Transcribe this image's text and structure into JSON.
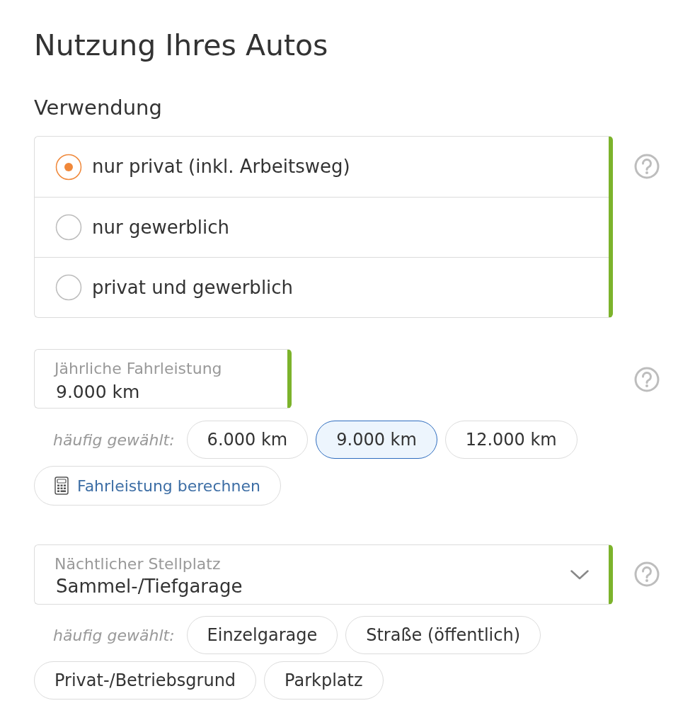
{
  "title": "Nutzung Ihres Autos",
  "usage": {
    "heading": "Verwendung",
    "valid": true,
    "options": [
      {
        "label": "nur privat (inkl. Arbeitsweg)",
        "selected": true
      },
      {
        "label": "nur gewerblich",
        "selected": false
      },
      {
        "label": "privat und gewerblich",
        "selected": false
      }
    ]
  },
  "mileage": {
    "label": "Jährliche Fahrleistung",
    "value": "9.000 km",
    "valid": true,
    "suggestions_label": "häufig gewählt:",
    "suggestions": [
      {
        "label": "6.000 km",
        "selected": false
      },
      {
        "label": "9.000 km",
        "selected": true
      },
      {
        "label": "12.000 km",
        "selected": false
      }
    ],
    "calculate_button": "Fahrleistung berechnen"
  },
  "parking": {
    "label": "Nächtlicher Stellplatz",
    "value": "Sammel-/Tiefgarage",
    "valid": true,
    "suggestions_label": "häufig gewählt:",
    "suggestions": [
      {
        "label": "Einzelgarage",
        "selected": false
      },
      {
        "label": "Straße (öffentlich)",
        "selected": false
      },
      {
        "label": "Privat-/Betriebsgrund",
        "selected": false
      },
      {
        "label": "Parkplatz",
        "selected": false
      }
    ]
  }
}
